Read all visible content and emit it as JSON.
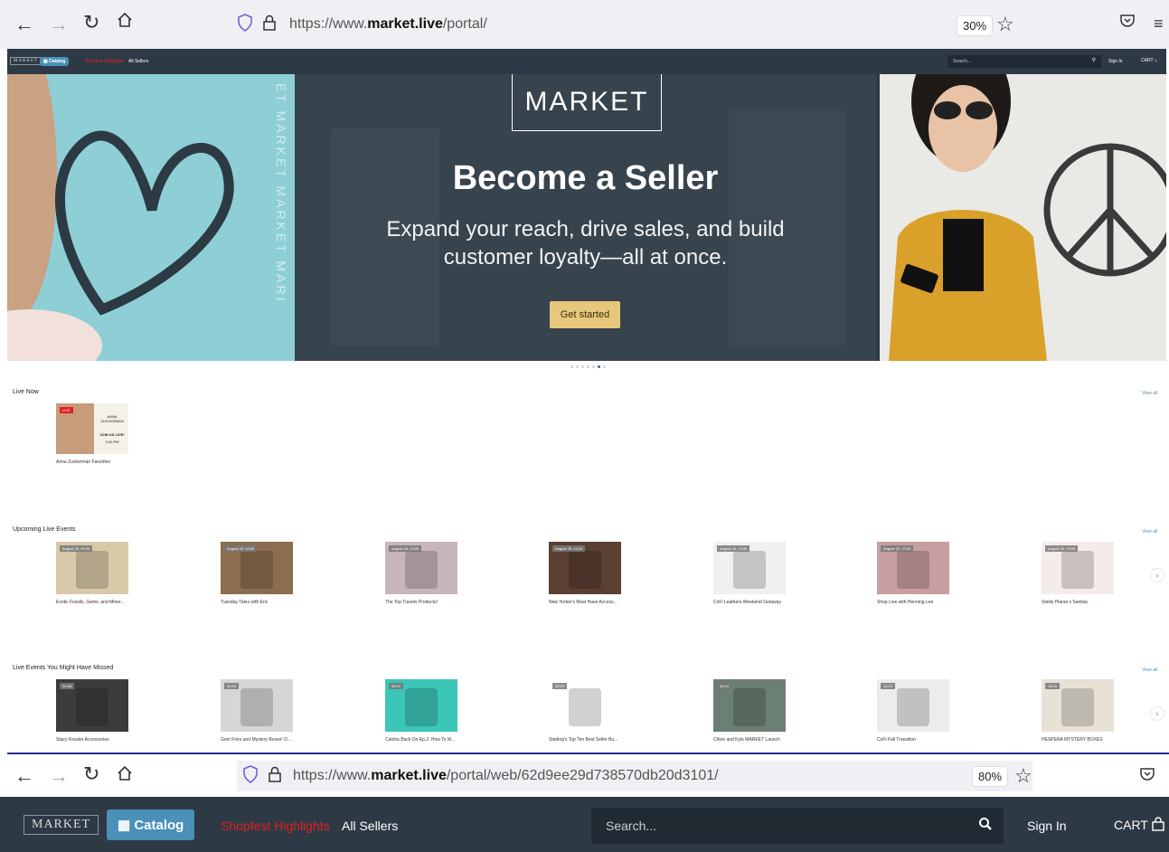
{
  "top_browser": {
    "url_prefix": "https://www.",
    "url_host": "market.live",
    "url_path": "/portal/",
    "zoom": "30%"
  },
  "top_site_nav": {
    "logo": "MARKET",
    "catalog": "Catalog",
    "highlights": "Shopfest Highlights",
    "all_sellers": "All Sellers",
    "search_placeholder": "Search...",
    "sign_in": "Sign In",
    "cart": "CART"
  },
  "hero": {
    "logo": "MARKET",
    "title": "Become a Seller",
    "subtitle": "Expand your reach, drive sales, and build customer loyalty—all at once.",
    "cta": "Get started",
    "side_text": "ET MARKET MARKET MARI"
  },
  "live_now": {
    "title": "Live Now",
    "view_all": "View all",
    "items": [
      {
        "caption": "Anna Zuckerman Favorites",
        "poster_name": "ANNA ZUCKERMAN",
        "poster_text": "JOIN US LIVE!",
        "poster_time": "3:00 PM",
        "badge": "LIVE"
      }
    ]
  },
  "upcoming": {
    "title": "Upcoming Live Events",
    "view_all": "View all",
    "items": [
      {
        "caption": "Exotic Fossils, Gems, and Miner...",
        "badge": "August 25, 09:00",
        "color": "#d9c9a8"
      },
      {
        "caption": "Tuesday Tales with Eric",
        "badge": "August 23, 16:30",
        "color": "#8b6d4f"
      },
      {
        "caption": "The Top Travels Products!",
        "badge": "August 26, 13:00",
        "color": "#c7b6b9"
      },
      {
        "caption": "New Yorker's Must Have Access...",
        "badge": "August 25, 11:00",
        "color": "#5b3f33"
      },
      {
        "caption": "CoFi Leathers Weekend Getaway",
        "badge": "August 26, 13:30",
        "color": "#f0f0f0"
      },
      {
        "caption": "Shop Live with Henning Lee",
        "badge": "August 22, 13:30",
        "color": "#c99ea2"
      },
      {
        "caption": "Vanity Planet x Sanitas",
        "badge": "August 28, 10:00",
        "color": "#f4ece8"
      }
    ]
  },
  "missed": {
    "title": "Live Events You Might Have Missed",
    "view_all": "View all",
    "items": [
      {
        "caption": "Stacy Kessler Accessories",
        "badge": "32:58",
        "color": "#3c3c3c"
      },
      {
        "caption": "Gem Fries and Mystery Boxes! O...",
        "badge": "40:26",
        "color": "#d6d6d6"
      },
      {
        "caption": "Catcha Back On Ep.2: How To M...",
        "badge": "45:21",
        "color": "#3bc6b7"
      },
      {
        "caption": "Starling's Top Ten Best Seller Bu...",
        "badge": "09:25",
        "color": "#ffffff"
      },
      {
        "caption": "Chloe and Kylo MARKET Launch",
        "badge": "34:14",
        "color": "#6b7f72"
      },
      {
        "caption": "CoFi Fall Transition",
        "badge": "16:23",
        "color": "#ececec"
      },
      {
        "caption": "HESPERA MYSTERY BOXES",
        "badge": "16:00",
        "color": "#e8e2d6"
      }
    ]
  },
  "bottom_browser": {
    "url_prefix": "https://www.",
    "url_host": "market.live",
    "url_path": "/portal/web/62d9ee29d738570db20d3101/",
    "zoom": "80%"
  },
  "bottom_site_nav": {
    "logo": "MARKET",
    "catalog": "Catalog",
    "highlights": "Shopfest Highlights",
    "all_sellers": "All Sellers",
    "search_placeholder": "Search...",
    "sign_in": "Sign In",
    "cart": "CART"
  }
}
